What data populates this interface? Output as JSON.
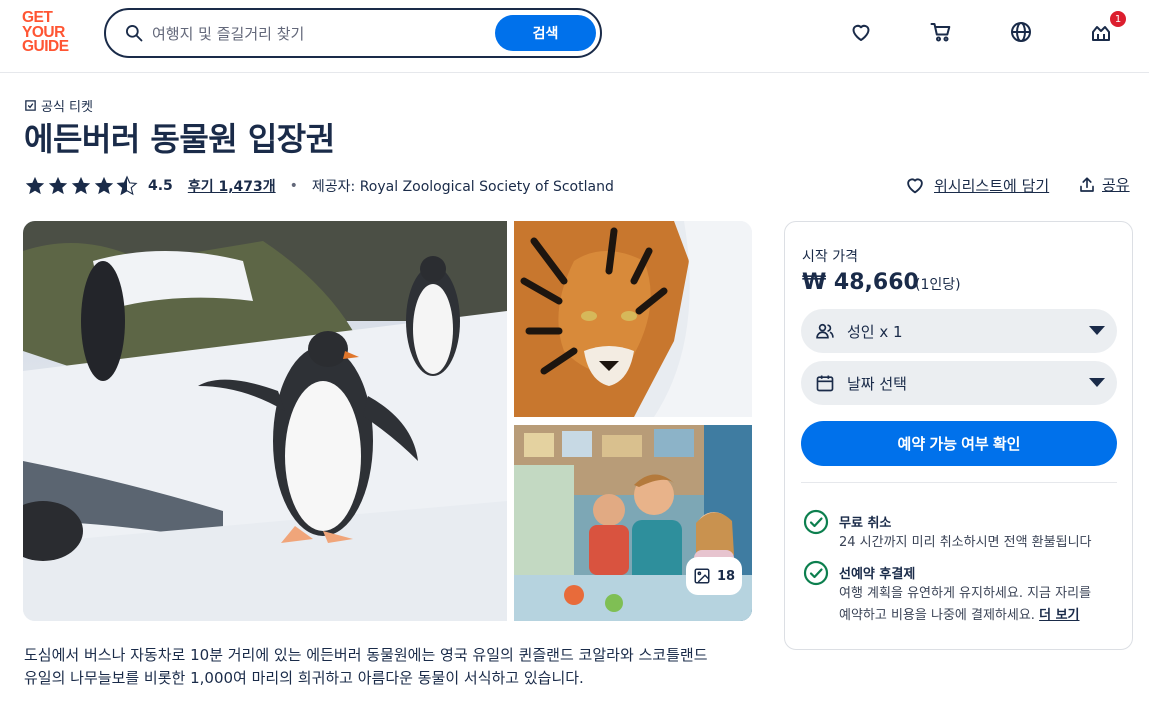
{
  "brand": {
    "logo_lines": [
      "GET",
      "YOUR",
      "GUIDE"
    ],
    "accent": "#ff5533",
    "primary": "#0071eb"
  },
  "search": {
    "placeholder": "여행지 및 즐길거리 찾기",
    "button_label": "검색"
  },
  "header_icons": [
    "heart-icon",
    "cart-icon",
    "globe-icon",
    "account-icon"
  ],
  "notification_count": "1",
  "product": {
    "badge": "공식 티켓",
    "title": "에든버러 동물원 입장권",
    "rating": "4.5",
    "reviews": "후기 1,473개",
    "separator": "•",
    "provider_label": "제공자:",
    "provider": "Royal Zoological Society of Scotland",
    "wishlist": "위시리스트에 담기",
    "share": "공유"
  },
  "gallery": {
    "photo_count": "18"
  },
  "booking": {
    "from_label": "시작 가격",
    "price": "₩ 48,660",
    "per": "(1인당)",
    "participants": "성인 x 1",
    "date": "날짜 선택",
    "check_button": "예약 가능 여부 확인",
    "features": [
      {
        "title": "무료 취소",
        "desc": "24 시간까지 미리 취소하시면 전액 환불됩니다"
      },
      {
        "title": "선예약 후결제",
        "desc_line1": "여행 계획을 유연하게 유지하세요. 지금 자리를",
        "desc_line2": "예약하고 비용을 나중에 결제하세요.",
        "more": "더 보기"
      }
    ]
  },
  "description": {
    "line1": "도심에서 버스나 자동차로 10분 거리에 있는 에든버러 동물원에는 영국 유일의 퀸즐랜드 코알라와 스코틀랜드",
    "line2": "유일의 나무늘보를 비롯한 1,000여 마리의 희귀하고 아름다운 동물이 서식하고 있습니다."
  }
}
